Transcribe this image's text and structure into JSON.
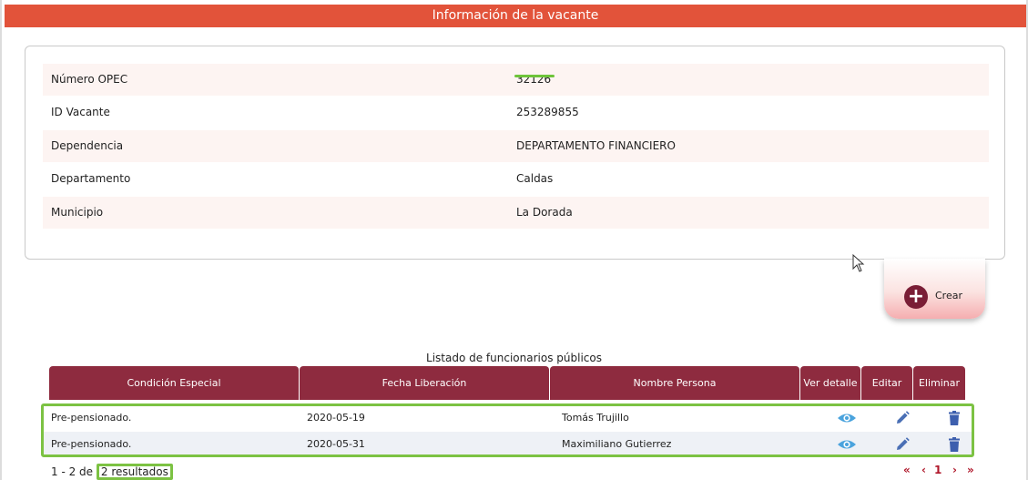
{
  "header": {
    "title": "Información de la vacante"
  },
  "info": [
    {
      "label": "Número OPEC",
      "value": "32126"
    },
    {
      "label": "ID Vacante",
      "value": "253289855"
    },
    {
      "label": "Dependencia",
      "value": "DEPARTAMENTO FINANCIERO"
    },
    {
      "label": "Departamento",
      "value": "Caldas"
    },
    {
      "label": "Municipio",
      "value": "La Dorada"
    }
  ],
  "create": {
    "label": "Crear",
    "icon": "plus-circle-icon"
  },
  "table": {
    "caption": "Listado de funcionarios públicos",
    "headers": [
      "Condición Especial",
      "Fecha Liberación",
      "Nombre Persona",
      "Ver detalle",
      "Editar",
      "Eliminar"
    ],
    "rows": [
      {
        "condicion": "Pre-pensionado.",
        "fecha": "2020-05-19",
        "nombre": "Tomás Trujillo"
      },
      {
        "condicion": "Pre-pensionado.",
        "fecha": "2020-05-31",
        "nombre": "Maximiliano Gutierrez"
      }
    ]
  },
  "pagination": {
    "range": "1 - 2 de",
    "results": "2 resultados",
    "first": "«",
    "prev": "‹",
    "current": "1",
    "next": "›",
    "last": "»"
  },
  "colors": {
    "header": "#e2533a",
    "table_header": "#8e2b3f",
    "highlight": "#7cc243",
    "action_icon": "#4a6fb5",
    "pager": "#b0182b"
  }
}
